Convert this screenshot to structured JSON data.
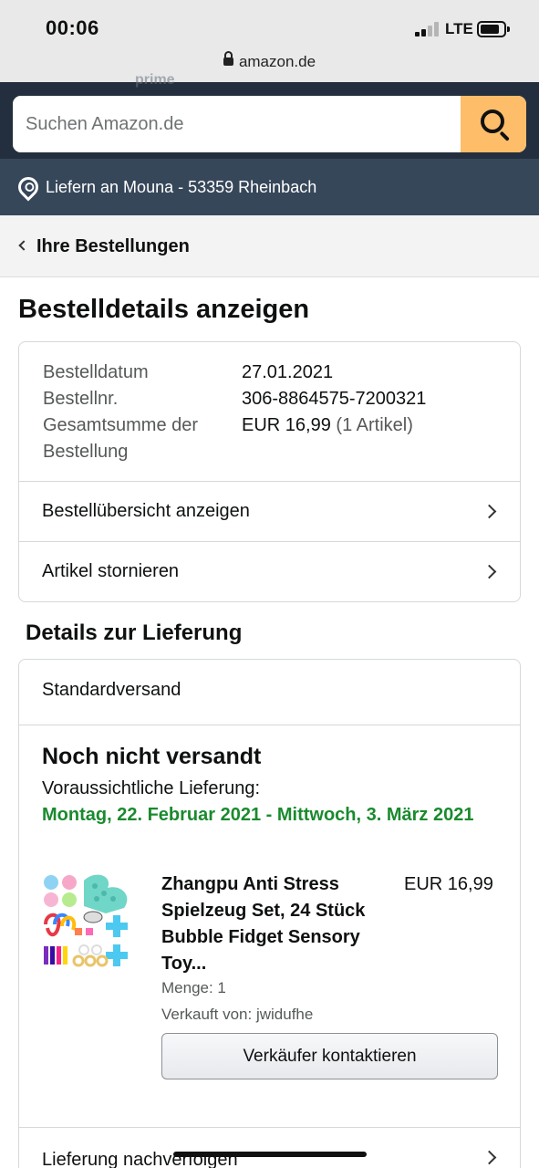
{
  "status_bar": {
    "time": "00:06",
    "network": "LTE"
  },
  "browser": {
    "url": "amazon.de",
    "ghost_text": "prime"
  },
  "search": {
    "placeholder": "Suchen Amazon.de",
    "icon": "search-icon"
  },
  "delivery": {
    "text": "Liefern an Mouna - 53359 Rheinbach",
    "icon": "location-pin-icon"
  },
  "breadcrumb": {
    "label": "Ihre Bestellungen"
  },
  "page_title": "Bestelldetails anzeigen",
  "order": {
    "date_label": "Bestelldatum",
    "date_value": "27.01.2021",
    "number_label": "Bestellnr.",
    "number_value": "306-8864575-7200321",
    "total_label_1": "Gesamtsumme der",
    "total_label_2": "Bestellung",
    "total_value": "EUR 16,99",
    "total_count": "(1 Artikel)",
    "summary_link": "Bestellübersicht anzeigen",
    "cancel_link": "Artikel stornieren"
  },
  "delivery_details": {
    "section_title": "Details zur Lieferung",
    "shipping_type": "Standardversand",
    "status": "Noch nicht versandt",
    "eta_label": "Voraussichtliche Lieferung:",
    "eta_value": "Montag, 22. Februar 2021 - Mittwoch, 3. März 2021",
    "product": {
      "title": "Zhangpu Anti Stress Spielzeug Set, 24 Stück Bubble Fidget Sensory Toy...",
      "price": "EUR 16,99",
      "quantity": "Menge: 1",
      "seller": "Verkauft von: jwidufhe",
      "contact_button": "Verkäufer kontaktieren"
    },
    "track_link": "Lieferung nachverfolgen"
  },
  "colors": {
    "header_bg": "#232f3e",
    "subheader_bg": "#37475a",
    "search_button": "#febd69",
    "eta_green": "#1a8a2e"
  }
}
